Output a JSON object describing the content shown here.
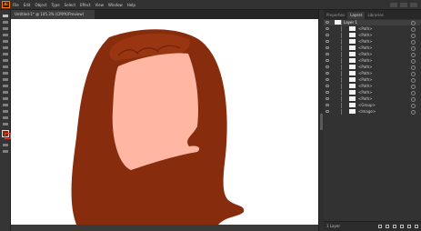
{
  "app": {
    "logo_text": "Ai"
  },
  "menu": [
    "File",
    "Edit",
    "Object",
    "Type",
    "Select",
    "Effect",
    "View",
    "Window",
    "Help"
  ],
  "document": {
    "tab_label": "Untitled-1* @ 145.3% (CMYK/Preview)"
  },
  "panel": {
    "tabs": [
      "Properties",
      "Layers",
      "Libraries"
    ],
    "active_tab": "Layers",
    "top_layer": "Layer 1",
    "sublayers": [
      "<Path>",
      "<Path>",
      "<Path>",
      "<Path>",
      "<Path>",
      "<Path>",
      "<Path>",
      "<Path>",
      "<Path>",
      "<Path>",
      "<Path>",
      "<Path>",
      "<Group>",
      "<Image>"
    ],
    "layer_count": "1 Layer"
  },
  "colors": {
    "hair": "#872c0c",
    "hair_highlight": "#9a3512",
    "face": "#ffb6a3",
    "layer_color": "#4f6fd8",
    "artboard": "#ffffff"
  }
}
